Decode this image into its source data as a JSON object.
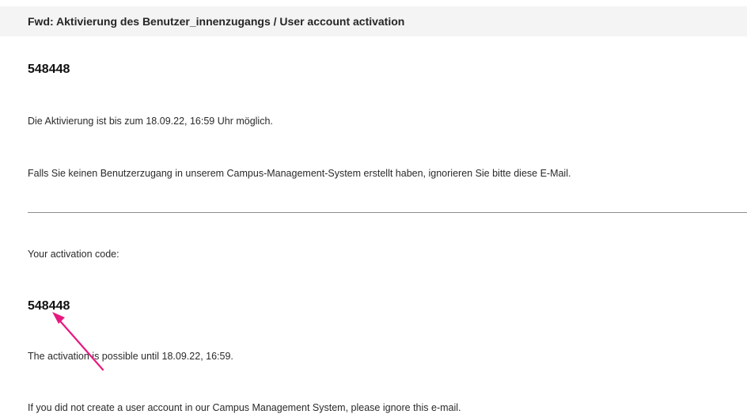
{
  "email": {
    "subject": "Fwd: Aktivierung des Benutzer_innenzugangs / User account activation",
    "german": {
      "code": "548448",
      "validity": "Die Aktivierung ist bis zum 18.09.22, 16:59 Uhr möglich.",
      "ignore_notice": "Falls Sie keinen Benutzerzugang in unserem Campus-Management-System erstellt haben, ignorieren Sie bitte diese E-Mail."
    },
    "english": {
      "code_label": "Your activation code:",
      "code": "548448",
      "validity": "The activation is possible until 18.09.22, 16:59.",
      "ignore_notice": "If you did not create a user account in our Campus Management System, please ignore this e-mail."
    }
  },
  "colors": {
    "subject_background": "#f4f4f4",
    "annotation_arrow": "#e6197f",
    "divider": "#8f8f8f"
  }
}
